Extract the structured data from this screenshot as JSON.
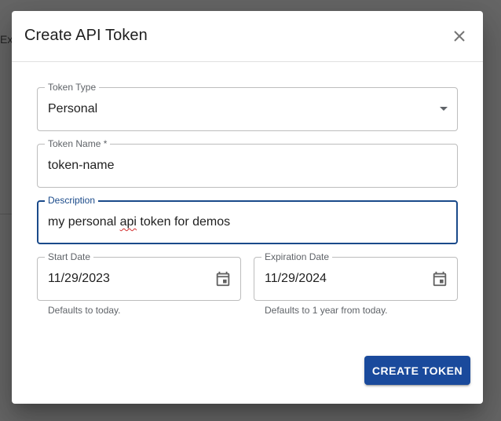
{
  "background": {
    "partial_text": "Exp"
  },
  "dialog": {
    "title": "Create API Token",
    "close_icon": "close-icon"
  },
  "fields": {
    "token_type": {
      "label": "Token Type",
      "value": "Personal"
    },
    "token_name": {
      "label": "Token Name *",
      "value": "token-name"
    },
    "description": {
      "label": "Description",
      "value_before": "my personal ",
      "value_misspelled": "api",
      "value_after": " token for demos"
    },
    "start_date": {
      "label": "Start Date",
      "value": "11/29/2023",
      "helper": "Defaults to today."
    },
    "expiration_date": {
      "label": "Expiration Date",
      "value": "11/29/2024",
      "helper": "Defaults to 1 year from today."
    }
  },
  "actions": {
    "create_label": "CREATE TOKEN"
  },
  "colors": {
    "primary": "#1a4a9c",
    "focus": "#1a4a8a",
    "scrim": "#666666",
    "spellcheck": "#d32f2f"
  }
}
